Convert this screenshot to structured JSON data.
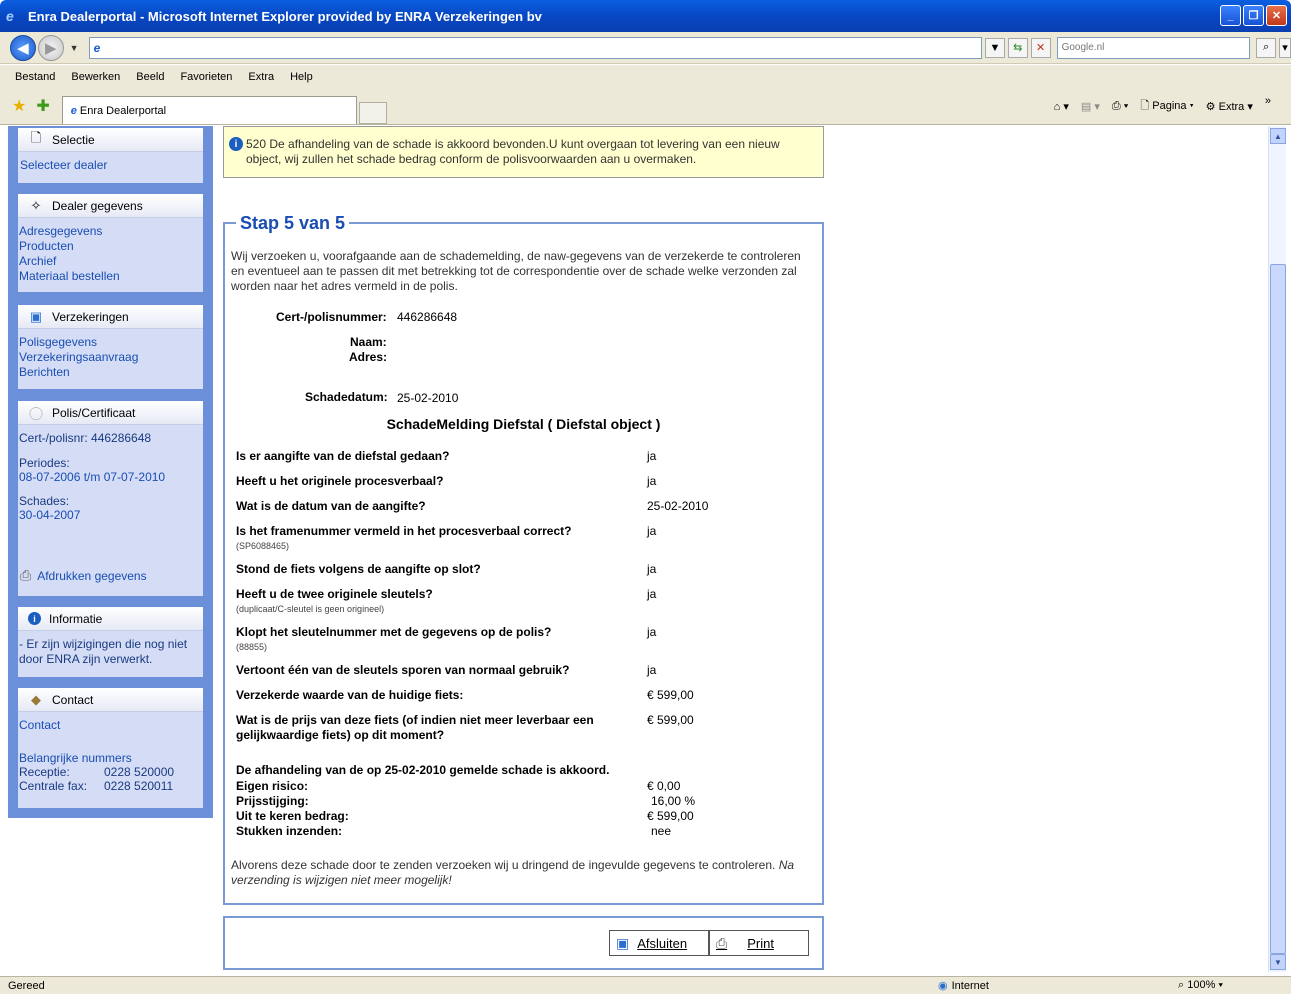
{
  "window": {
    "title": "Enra Dealerportal - Microsoft Internet Explorer provided by ENRA Verzekeringen bv"
  },
  "address": {
    "search_placeholder": "Google.nl"
  },
  "menu": [
    "Bestand",
    "Bewerken",
    "Beeld",
    "Favorieten",
    "Extra",
    "Help"
  ],
  "tab": {
    "label": "Enra Dealerportal"
  },
  "toolbar": {
    "pagina": "Pagina",
    "extra": "Extra"
  },
  "sidebar": {
    "selectie": {
      "title": "Selectie",
      "link": "Selecteer dealer"
    },
    "dealer": {
      "title": "Dealer gegevens",
      "links": [
        "Adresgegevens",
        "Producten",
        "Archief",
        "Materiaal bestellen"
      ]
    },
    "verzekeringen": {
      "title": "Verzekeringen",
      "links": [
        "Polisgegevens",
        "Verzekeringsaanvraag",
        "Berichten"
      ]
    },
    "polis": {
      "title": "Polis/Certificaat",
      "cert": "Cert-/polisnr: 446286648",
      "periodes_label": "Periodes:",
      "periodes_value": "08-07-2006 t/m 07-07-2010",
      "schades_label": "Schades:",
      "schades_value": "30-04-2007",
      "print": "Afdrukken gegevens"
    },
    "informatie": {
      "title": "Informatie",
      "text": "- Er zijn wijzigingen die nog niet door ENRA zijn verwerkt."
    },
    "contact": {
      "title": "Contact",
      "link": "Contact",
      "important": "Belangrijke nummers",
      "receptie_label": "Receptie:",
      "receptie_value": "0228 520000",
      "fax_label": "Centrale fax:",
      "fax_value": "0228 520011"
    }
  },
  "notice": "520 De afhandeling van de schade is akkoord bevonden.U kunt overgaan tot levering van een nieuw object, wij zullen het schade bedrag conform de polisvoorwaarden aan u overmaken.",
  "step": {
    "title": "Stap 5 van 5",
    "intro": "Wij verzoeken u, voorafgaande aan de schademelding, de naw-gegevens van de verzekerde te controleren en eventueel aan te passen dit met betrekking tot de correspondentie over de schade welke verzonden zal worden naar het adres vermeld in de polis."
  },
  "fields": {
    "cert_label": "Cert-/polisnummer:",
    "cert_value": "446286648",
    "naam_label": "Naam:",
    "adres_label": "Adres:",
    "datum_label": "Schadedatum:",
    "datum_value": "25-02-2010"
  },
  "melding": {
    "title": "SchadeMelding Diefstal (  Diefstal object )"
  },
  "questions": [
    {
      "q": "Is er aangifte van de diefstal gedaan?",
      "sub": "",
      "a": "ja"
    },
    {
      "q": "Heeft u het originele procesverbaal?",
      "sub": "",
      "a": "ja"
    },
    {
      "q": "Wat is de datum van de aangifte?",
      "sub": "",
      "a": "25-02-2010"
    },
    {
      "q": "Is het framenummer vermeld in het procesverbaal correct?",
      "sub": "(SP6088465)",
      "a": "ja"
    },
    {
      "q": "Stond de fiets volgens de aangifte op slot?",
      "sub": "",
      "a": "ja"
    },
    {
      "q": "Heeft u de twee originele sleutels?",
      "sub": "(duplicaat/C-sleutel is geen origineel)",
      "a": "ja"
    },
    {
      "q": "Klopt het sleutelnummer met de gegevens op de polis?",
      "sub": "(88855)",
      "a": "ja"
    },
    {
      "q": "Vertoont één van de sleutels sporen van normaal gebruik?",
      "sub": "",
      "a": "ja"
    },
    {
      "q": "Verzekerde waarde van de huidige fiets:",
      "sub": "",
      "a": "€ 599,00"
    },
    {
      "q": "Wat is de prijs van deze fiets (of indien niet meer leverbaar een gelijkwaardige fiets) op dit moment?",
      "sub": "",
      "a": "€ 599,00"
    }
  ],
  "summary": {
    "title": "De afhandeling van de op 25-02-2010 gemelde schade is akkoord.",
    "rows": [
      {
        "label": "Eigen risico:",
        "value": "€ 0,00"
      },
      {
        "label": "Prijsstijging:",
        "value": "16,00 %"
      },
      {
        "label": "Uit te keren bedrag:",
        "value": "€ 599,00"
      },
      {
        "label": "Stukken inzenden:",
        "value": "nee"
      }
    ]
  },
  "footer_note": {
    "normal": "Alvorens deze schade door te zenden verzoeken wij u dringend de ingevulde gegevens te controleren. ",
    "italic": "Na verzending is wijzigen niet meer mogelijk!"
  },
  "buttons": {
    "close": "Afsluiten",
    "print": "Print"
  },
  "status": {
    "left": "Gereed",
    "zone": "Internet",
    "zoom": "100%"
  }
}
